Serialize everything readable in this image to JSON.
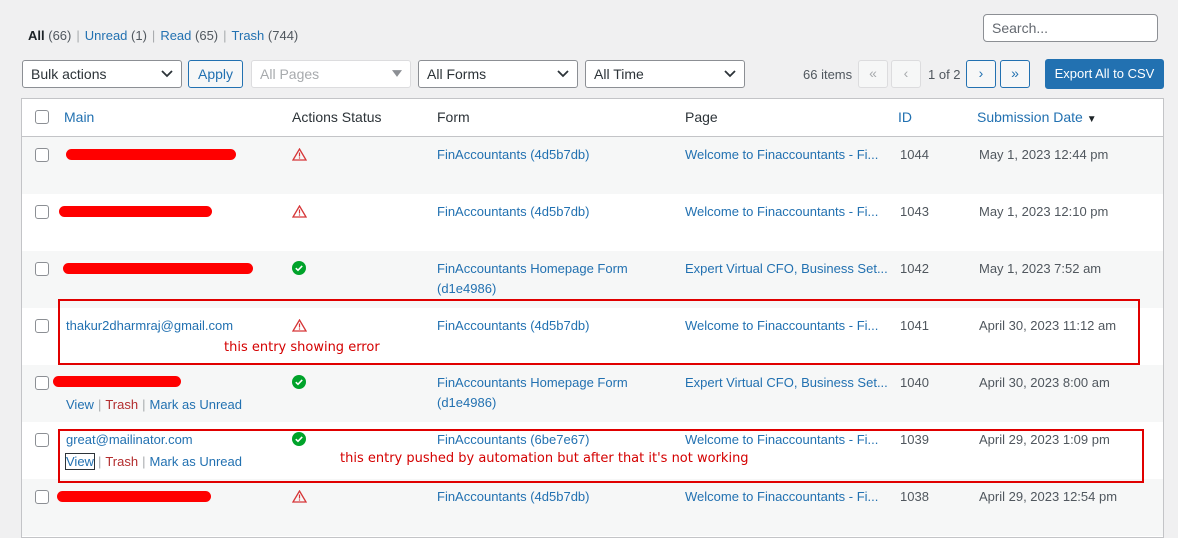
{
  "filters": {
    "all_label": "All",
    "all_count": "(66)",
    "unread_label": "Unread",
    "unread_count": "(1)",
    "read_label": "Read",
    "read_count": "(65)",
    "trash_label": "Trash",
    "trash_count": "(744)",
    "separator": "|"
  },
  "search": {
    "placeholder": "Search..."
  },
  "toolbar": {
    "bulk_actions": "Bulk actions",
    "apply": "Apply",
    "pages_filter": "All Pages",
    "forms_filter": "All Forms",
    "time_filter": "All Time",
    "items_count": "66 items",
    "first_page": "«",
    "prev_page": "‹",
    "page_of": "1 of 2",
    "next_page": "›",
    "last_page": "»",
    "export": "Export All to CSV"
  },
  "columns": {
    "main": "Main",
    "status": "Actions Status",
    "form": "Form",
    "page": "Page",
    "id": "ID",
    "date": "Submission Date",
    "sort_indicator": "▼"
  },
  "row_actions": {
    "view": "View",
    "trash": "Trash",
    "mark_unread": "Mark as Unread",
    "separator": "|"
  },
  "rows": [
    {
      "main": "",
      "status": "error",
      "form": "FinAccountants (4d5b7db)",
      "form2": "",
      "page": "Welcome to Finaccountants - Fi...",
      "id": "1044",
      "date": "May 1, 2023 12:44 pm"
    },
    {
      "main": "",
      "status": "error",
      "form": "FinAccountants (4d5b7db)",
      "form2": "",
      "page": "Welcome to Finaccountants - Fi...",
      "id": "1043",
      "date": "May 1, 2023 12:10 pm"
    },
    {
      "main": "",
      "status": "success",
      "form": "FinAccountants Homepage Form",
      "form2": "(d1e4986)",
      "page": "Expert Virtual CFO, Business Set...",
      "id": "1042",
      "date": "May 1, 2023 7:52 am"
    },
    {
      "main": "thakur2dharmraj@gmail.com",
      "status": "error",
      "form": "FinAccountants (4d5b7db)",
      "form2": "",
      "page": "Welcome to Finaccountants - Fi...",
      "id": "1041",
      "date": "April 30, 2023 11:12 am"
    },
    {
      "main": "",
      "status": "success",
      "form": "FinAccountants Homepage Form",
      "form2": "(d1e4986)",
      "page": "Expert Virtual CFO, Business Set...",
      "id": "1040",
      "date": "April 30, 2023 8:00 am"
    },
    {
      "main": "great@mailinator.com",
      "status": "success",
      "form": "FinAccountants (6be7e67)",
      "form2": "",
      "page": "Welcome to Finaccountants - Fi...",
      "id": "1039",
      "date": "April 29, 2023 1:09 pm"
    },
    {
      "main": "",
      "status": "error",
      "form": "FinAccountants (4d5b7db)",
      "form2": "",
      "page": "Welcome to Finaccountants - Fi...",
      "id": "1038",
      "date": "April 29, 2023 12:54 pm"
    }
  ],
  "annotations": {
    "error_note": "this entry showing error",
    "automation_note": "this entry pushed by automation but after that it's not working"
  },
  "colors": {
    "accent": "#2271b1",
    "error": "#d63638",
    "success": "#00a32a",
    "annotation": "#e00000"
  }
}
